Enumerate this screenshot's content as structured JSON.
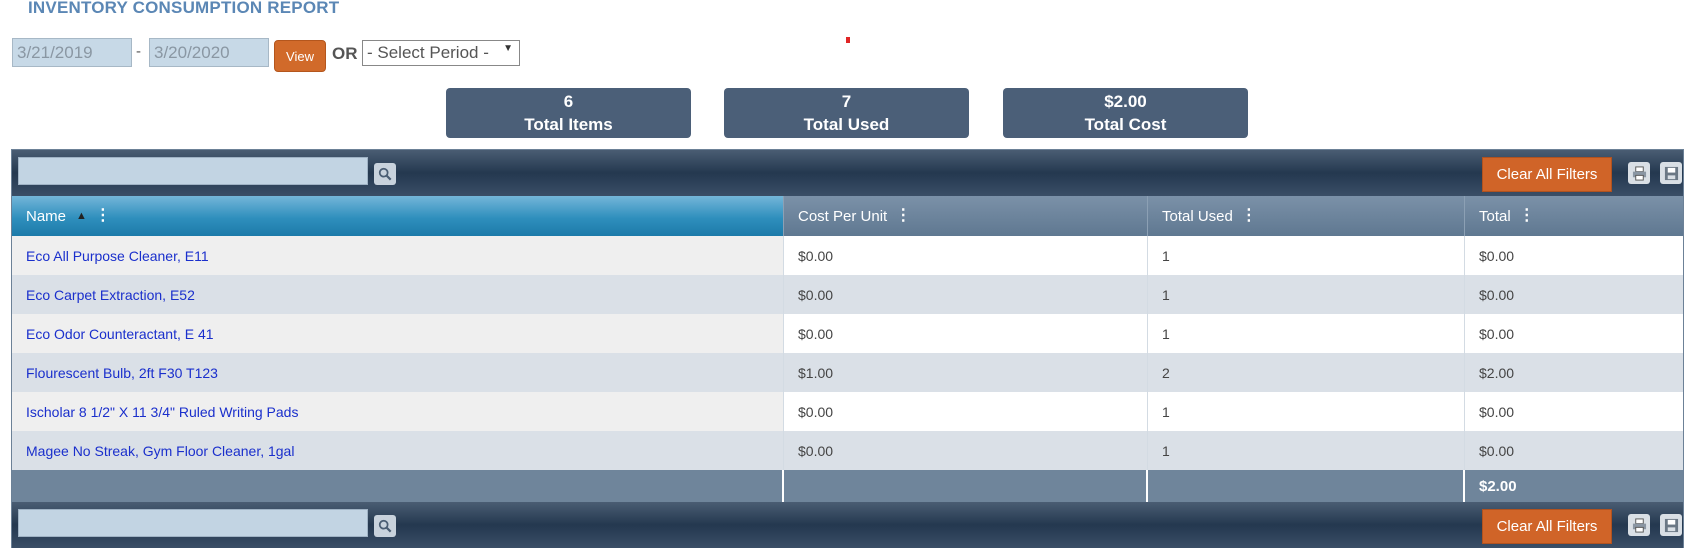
{
  "report": {
    "title": "INVENTORY CONSUMPTION REPORT",
    "date_from": "3/21/2019",
    "date_separator": "-",
    "date_to": "3/20/2020",
    "view_label": "View",
    "or_label": "OR",
    "period_placeholder": "- Select Period -"
  },
  "stats": [
    {
      "value": "6",
      "label": "Total Items"
    },
    {
      "value": "7",
      "label": "Total Used"
    },
    {
      "value": "$2.00",
      "label": "Total Cost"
    }
  ],
  "grid": {
    "clear_filters_label": "Clear All Filters",
    "columns": [
      "Name",
      "Cost Per Unit",
      "Total Used",
      "Total"
    ],
    "rows": [
      {
        "name": "Eco All Purpose Cleaner, E11",
        "cost": "$0.00",
        "used": "1",
        "total": "$0.00"
      },
      {
        "name": "Eco Carpet Extraction, E52",
        "cost": "$0.00",
        "used": "1",
        "total": "$0.00"
      },
      {
        "name": "Eco Odor Counteractant, E 41",
        "cost": "$0.00",
        "used": "1",
        "total": "$0.00"
      },
      {
        "name": "Flourescent Bulb, 2ft F30 T123",
        "cost": "$1.00",
        "used": "2",
        "total": "$2.00"
      },
      {
        "name": "Ischolar 8 1/2\" X 11 3/4\" Ruled Writing Pads",
        "cost": "$0.00",
        "used": "1",
        "total": "$0.00"
      },
      {
        "name": "Magee No Streak, Gym Floor Cleaner, 1gal",
        "cost": "$0.00",
        "used": "1",
        "total": "$0.00"
      }
    ],
    "footer_total": "$2.00"
  },
  "colors": {
    "accent_orange": "#d06428",
    "header_blue": "#2f8fbd",
    "stat_bg": "#4b5f78",
    "link_blue": "#1a2fcc"
  }
}
